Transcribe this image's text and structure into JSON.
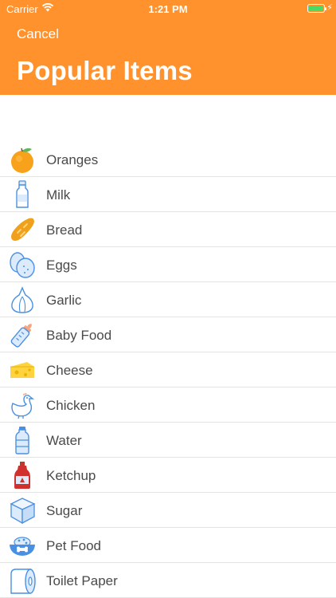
{
  "status_bar": {
    "carrier": "Carrier",
    "time": "1:21 PM"
  },
  "nav": {
    "cancel_label": "Cancel",
    "title": "Popular Items"
  },
  "colors": {
    "accent": "#FF922C",
    "icon_blue": "#4A90E2",
    "icon_light": "#DCEBFB"
  },
  "items": [
    {
      "label": "Oranges",
      "icon": "orange-icon"
    },
    {
      "label": "Milk",
      "icon": "milk-bottle-icon"
    },
    {
      "label": "Bread",
      "icon": "bread-icon"
    },
    {
      "label": "Eggs",
      "icon": "eggs-icon"
    },
    {
      "label": "Garlic",
      "icon": "garlic-icon"
    },
    {
      "label": "Baby Food",
      "icon": "baby-bottle-icon"
    },
    {
      "label": "Cheese",
      "icon": "cheese-icon"
    },
    {
      "label": "Chicken",
      "icon": "chicken-icon"
    },
    {
      "label": "Water",
      "icon": "water-bottle-icon"
    },
    {
      "label": "Ketchup",
      "icon": "ketchup-icon"
    },
    {
      "label": "Sugar",
      "icon": "sugar-cube-icon"
    },
    {
      "label": "Pet Food",
      "icon": "pet-food-bowl-icon"
    },
    {
      "label": "Toilet Paper",
      "icon": "toilet-paper-icon"
    }
  ]
}
